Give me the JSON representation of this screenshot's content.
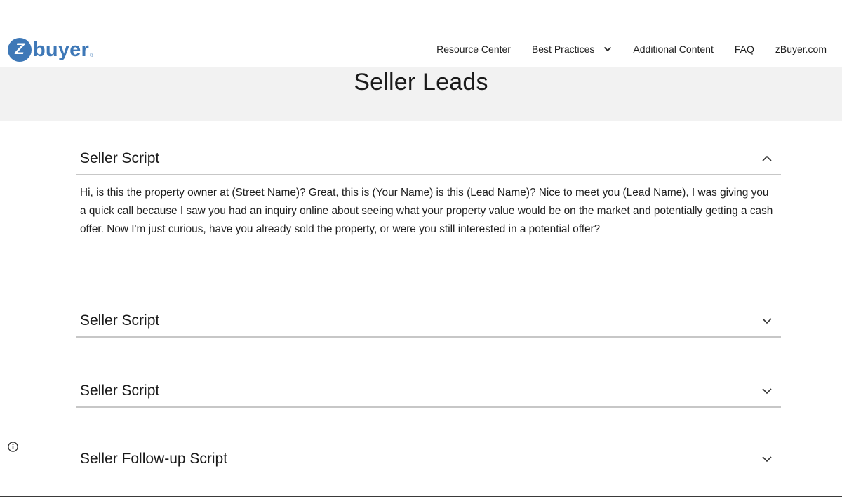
{
  "brand": {
    "logo_mark": "Z",
    "logo_text": "buyer",
    "logo_reg": "®"
  },
  "nav": {
    "items": [
      "Resource Center",
      "Best Practices",
      "Additional Content",
      "FAQ",
      "zBuyer.com"
    ]
  },
  "page": {
    "title": "Seller Leads"
  },
  "accordion": [
    {
      "title": "Seller Script",
      "expanded": true,
      "body": "Hi, is this the property owner at (Street Name)? Great, this is (Your Name) is this (Lead Name)? Nice to meet you (Lead Name), I was giving you a quick call because I saw you had an inquiry online about seeing what your property value would be on the market and potentially getting a cash offer. Now I'm just curious, have you already sold the property, or were you still interested in a potential offer?"
    },
    {
      "title": "Seller Script",
      "expanded": false
    },
    {
      "title": "Seller Script",
      "expanded": false
    },
    {
      "title": "Seller Follow-up Script",
      "expanded": false
    }
  ],
  "icons": {
    "expanded": "chevron-up-icon",
    "collapsed": "chevron-down-icon",
    "nav_dropdown": "chevron-down-icon",
    "info": "info-icon"
  },
  "colors": {
    "brand_blue": "#3e78b7",
    "title_band": "#f2f2f2",
    "divider": "#c7c7c7"
  }
}
